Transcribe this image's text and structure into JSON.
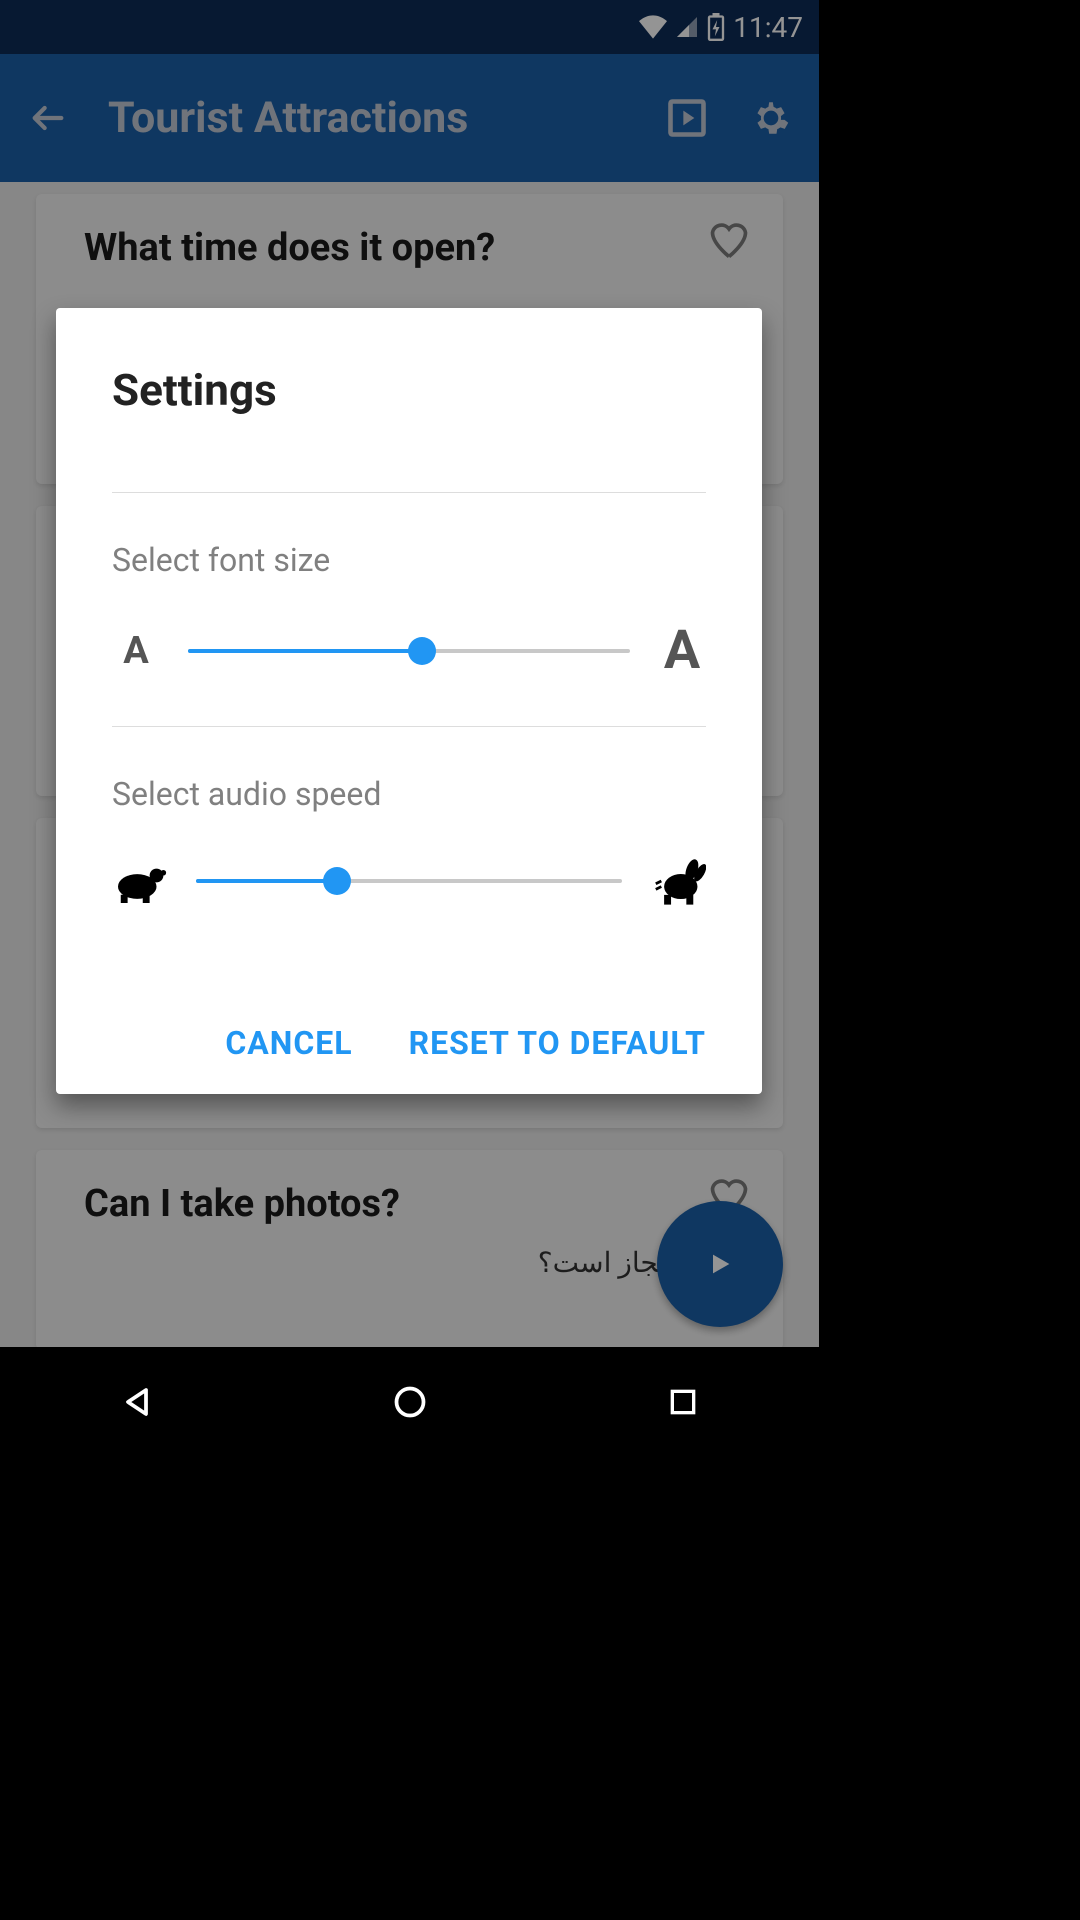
{
  "status": {
    "time": "11:47"
  },
  "appbar": {
    "title": "Tourist Attractions"
  },
  "cards": [
    {
      "title": "What time does it open?"
    },
    {
      "title": ""
    },
    {
      "title": ""
    },
    {
      "title": "Can I take photos?",
      "subtitle": "اسی مجاز است؟"
    }
  ],
  "dialog": {
    "title": "Settings",
    "font_label": "Select font size",
    "small_a": "A",
    "big_a": "A",
    "font_slider_percent": 53,
    "audio_label": "Select audio speed",
    "audio_slider_percent": 33,
    "cancel": "CANCEL",
    "reset": "RESET TO DEFAULT"
  }
}
